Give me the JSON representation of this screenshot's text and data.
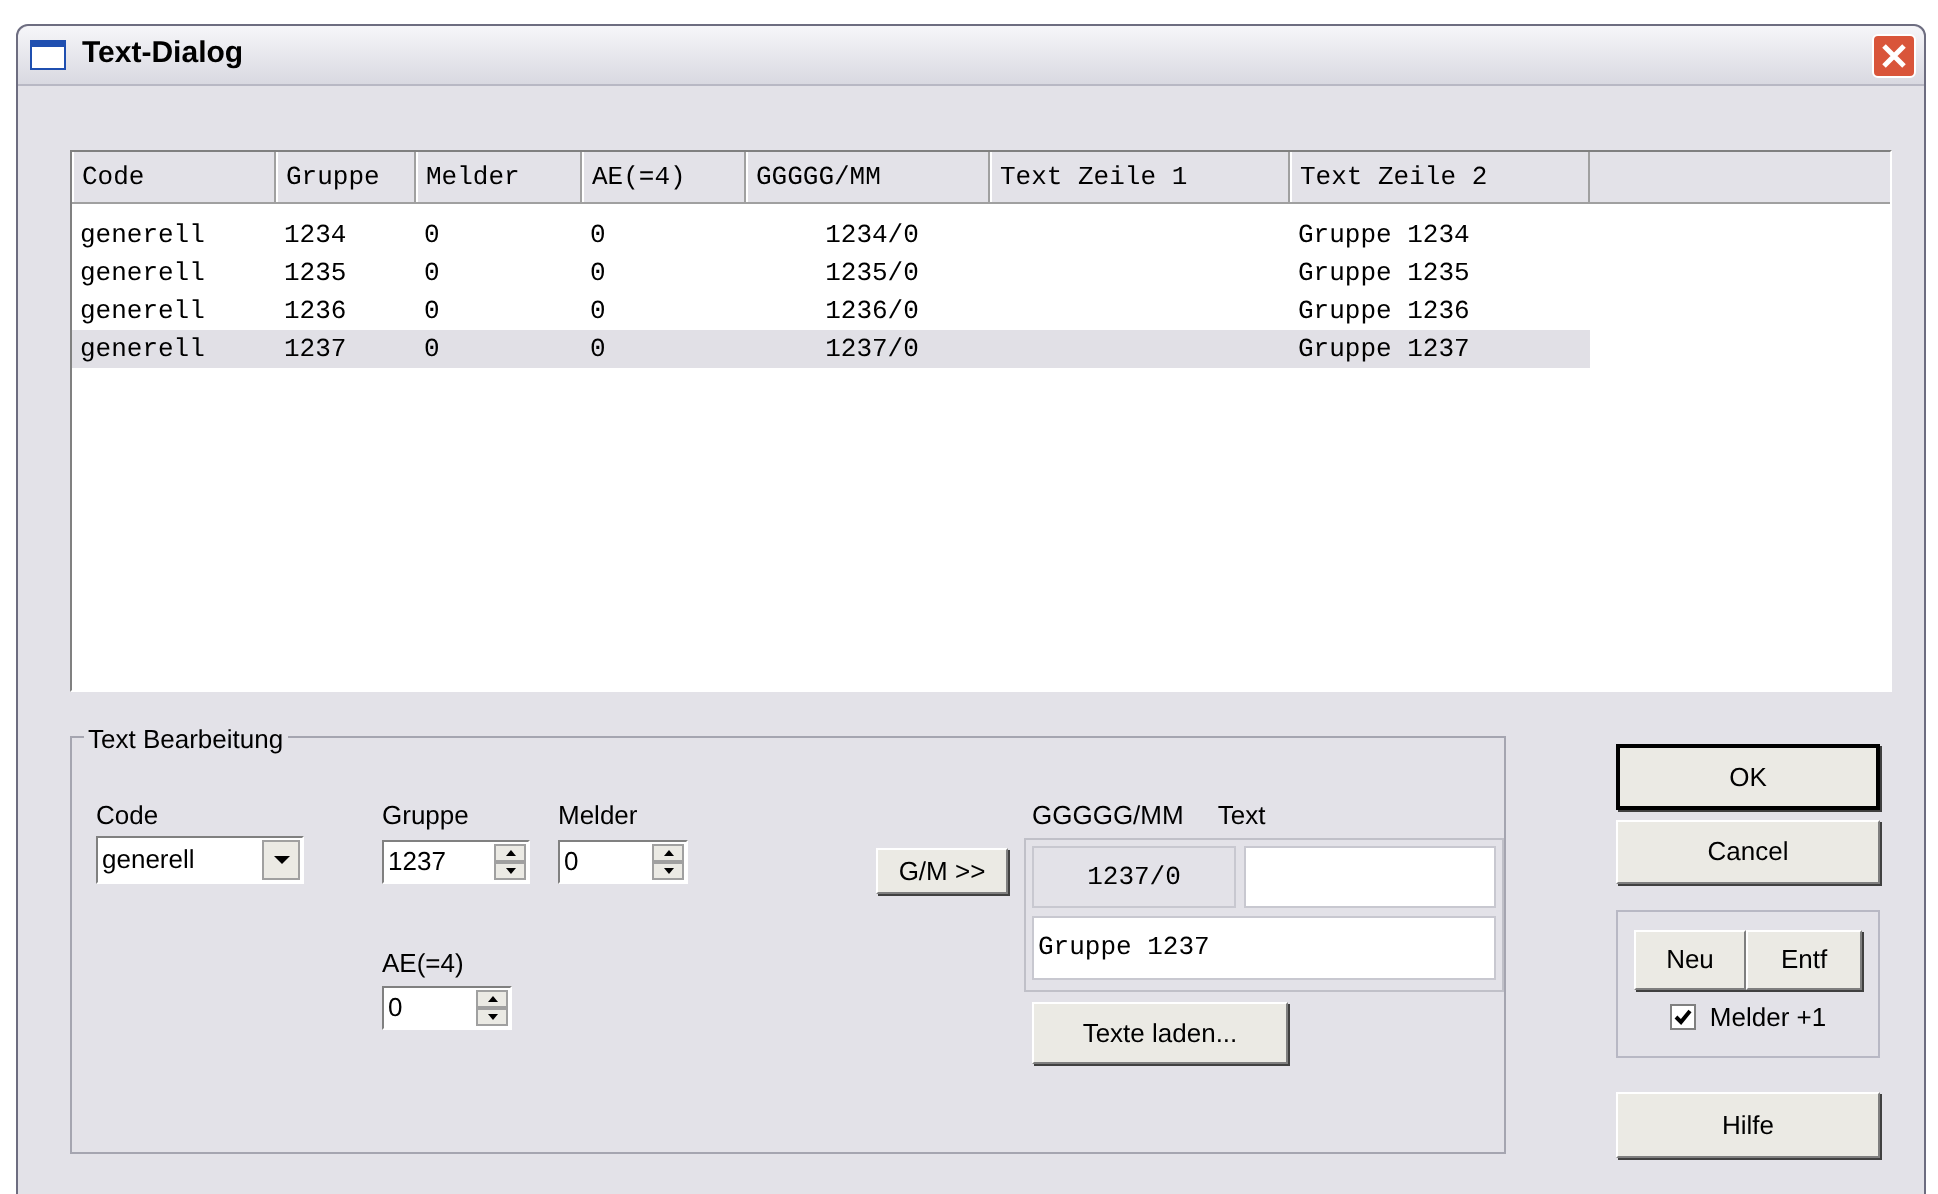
{
  "window": {
    "title": "Text-Dialog"
  },
  "table": {
    "columns": [
      "Code",
      "Gruppe",
      "Melder",
      "AE(=4)",
      "GGGGG/MM",
      "Text Zeile 1",
      "Text Zeile 2"
    ],
    "rows": [
      {
        "cells": [
          "generell",
          "1234",
          "0",
          "0",
          "1234/0",
          null,
          "Gruppe 1234"
        ],
        "selected": false
      },
      {
        "cells": [
          "generell",
          "1235",
          "0",
          "0",
          "1235/0",
          null,
          "Gruppe 1235"
        ],
        "selected": false
      },
      {
        "cells": [
          "generell",
          "1236",
          "0",
          "0",
          "1236/0",
          null,
          "Gruppe 1236"
        ],
        "selected": false
      },
      {
        "cells": [
          "generell",
          "1237",
          "0",
          "0",
          "1237/0",
          null,
          "Gruppe 1237"
        ],
        "selected": true
      }
    ]
  },
  "edit_group": {
    "title": "Text Bearbeitung",
    "code": {
      "label": "Code",
      "value": "generell"
    },
    "gruppe": {
      "label": "Gruppe",
      "value": "1237"
    },
    "melder": {
      "label": "Melder",
      "value": "0"
    },
    "ae": {
      "label": "AE(=4)",
      "value": "0"
    },
    "gm_button": "G/M >>",
    "gm_label": "GGGGG/MM",
    "text_label": "Text",
    "gm_value": "1237/0",
    "text_line2": "Gruppe 1237",
    "load_button": "Texte laden..."
  },
  "buttons": {
    "ok": "OK",
    "cancel": "Cancel",
    "neu": "Neu",
    "entf": "Entf",
    "hilfe": "Hilfe"
  },
  "melder_plus": {
    "label": "Melder +1",
    "checked": true
  }
}
